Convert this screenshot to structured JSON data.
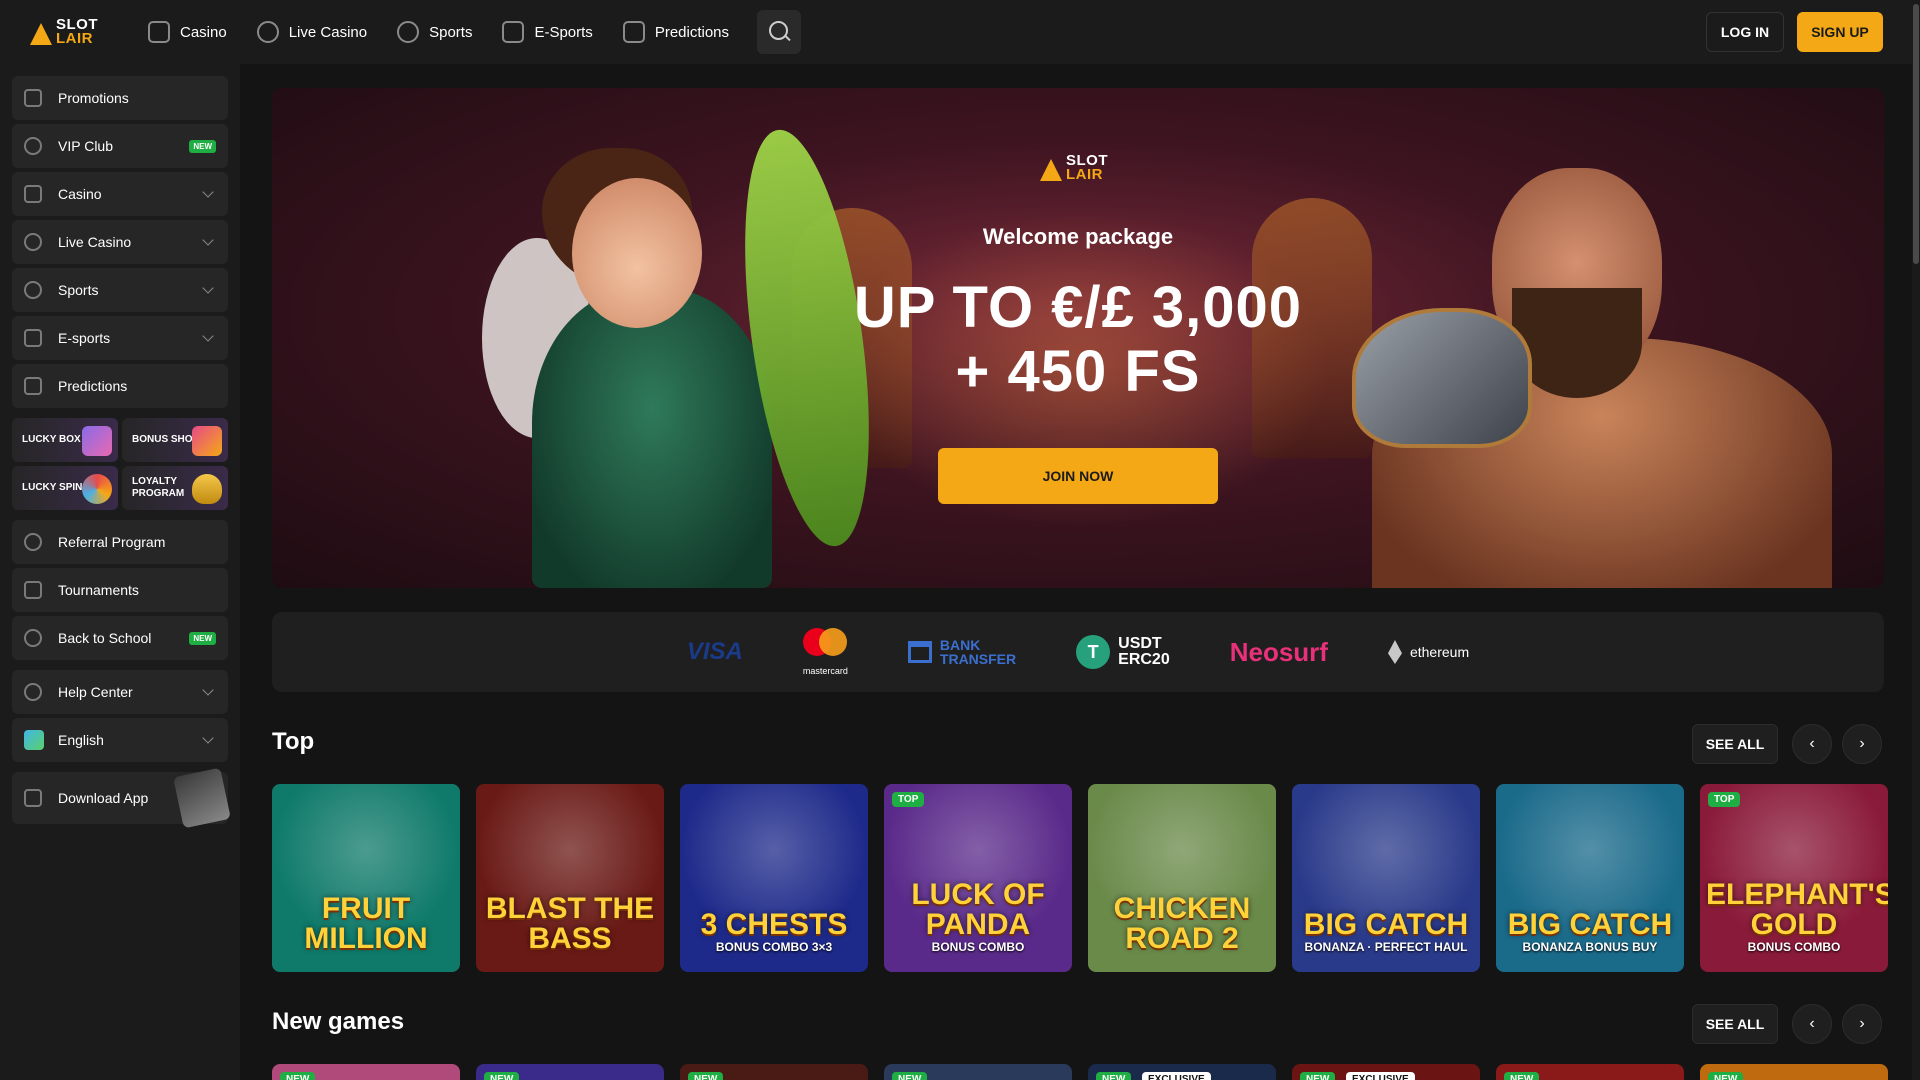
{
  "header": {
    "logo": {
      "line1": "SLOT",
      "line2": "LAIR"
    },
    "nav": [
      {
        "label": "Casino",
        "icon": "slot-machine-icon"
      },
      {
        "label": "Live Casino",
        "icon": "dealer-icon"
      },
      {
        "label": "Sports",
        "icon": "soccer-ball-icon"
      },
      {
        "label": "E-Sports",
        "icon": "gamepad-icon"
      },
      {
        "label": "Predictions",
        "icon": "chart-icon"
      }
    ],
    "login_label": "LOG IN",
    "signup_label": "SIGN UP"
  },
  "sidebar": {
    "items": [
      {
        "label": "Promotions",
        "icon": "gift-icon"
      },
      {
        "label": "VIP Club",
        "icon": "vip-icon",
        "badge": "NEW"
      },
      {
        "label": "Casino",
        "icon": "slot-machine-icon"
      },
      {
        "label": "Live Casino",
        "icon": "dealer-icon"
      },
      {
        "label": "Sports",
        "icon": "soccer-ball-icon"
      },
      {
        "label": "E-sports",
        "icon": "gamepad-icon"
      },
      {
        "label": "Predictions",
        "icon": "chart-icon"
      }
    ],
    "tiles": [
      {
        "label": "LUCKY BOX"
      },
      {
        "label": "BONUS SHOP"
      },
      {
        "label": "LUCKY SPIN"
      },
      {
        "label": "LOYALTY PROGRAM"
      }
    ],
    "items2": [
      {
        "label": "Referral Program",
        "icon": "users-icon"
      },
      {
        "label": "Tournaments",
        "icon": "trophy-icon"
      },
      {
        "label": "Back to School",
        "icon": "target-icon",
        "badge": "NEW"
      },
      {
        "label": "Help Center",
        "icon": "help-icon"
      },
      {
        "label": "English",
        "icon": "globe-flag-icon"
      },
      {
        "label": "Download App",
        "icon": "download-icon"
      }
    ]
  },
  "hero": {
    "logo": {
      "line1": "SLOT",
      "line2": "LAIR"
    },
    "title": "Welcome package",
    "amount_line1": "UP TO €/£ 3,000",
    "amount_line2": "+ 450 FS",
    "cta_label": "JOIN NOW"
  },
  "payments": {
    "visa": "VISA",
    "mastercard": "mastercard",
    "bank_line1": "BANK",
    "bank_line2": "TRANSFER",
    "usdt_line1": "USDT",
    "usdt_line2": "ERC20",
    "neosurf": "Neosurf",
    "ethereum": "ethereum"
  },
  "sections": {
    "top": {
      "title": "Top",
      "see_all": "SEE ALL"
    },
    "new_games": {
      "title": "New games",
      "see_all": "SEE ALL"
    }
  },
  "top_games": [
    {
      "title": "FRUIT MILLION",
      "sub": "",
      "tag": "",
      "bg": "#0f7a6a"
    },
    {
      "title": "BLAST THE BASS",
      "sub": "",
      "tag": "",
      "bg": "#6a1a16"
    },
    {
      "title": "3 CHESTS",
      "sub": "BONUS COMBO 3×3",
      "tag": "",
      "bg": "#1e2a8a"
    },
    {
      "title": "LUCK OF PANDA",
      "sub": "BONUS COMBO",
      "tag": "TOP",
      "bg": "#5a2a8a"
    },
    {
      "title": "CHICKEN ROAD 2",
      "sub": "",
      "tag": "",
      "bg": "#6a8a4a"
    },
    {
      "title": "BIG CATCH",
      "sub": "BONANZA · PERFECT HAUL",
      "tag": "",
      "bg": "#2a3a8a"
    },
    {
      "title": "BIG CATCH",
      "sub": "BONANZA BONUS BUY",
      "tag": "",
      "bg": "#1a6a8a"
    },
    {
      "title": "ELEPHANT'S GOLD",
      "sub": "BONUS COMBO",
      "tag": "TOP",
      "bg": "#8a1a3a"
    }
  ],
  "new_games": [
    {
      "tag": "NEW",
      "excl": "",
      "bg": "#b04a7a"
    },
    {
      "tag": "NEW",
      "excl": "",
      "bg": "#3a2a8a"
    },
    {
      "tag": "NEW",
      "excl": "",
      "bg": "#4a1a14"
    },
    {
      "tag": "NEW",
      "excl": "",
      "bg": "#2a3a5a"
    },
    {
      "tag": "NEW",
      "excl": "EXCLUSIVE",
      "bg": "#1a2a4a"
    },
    {
      "tag": "NEW",
      "excl": "EXCLUSIVE",
      "bg": "#6a1414"
    },
    {
      "tag": "NEW",
      "excl": "",
      "bg": "#8a1a1a"
    },
    {
      "tag": "NEW",
      "excl": "",
      "bg": "#c06a10"
    }
  ],
  "colors": {
    "accent": "#f5a815",
    "new_badge": "#1fae43",
    "background": "#141414",
    "panel": "#262626"
  }
}
